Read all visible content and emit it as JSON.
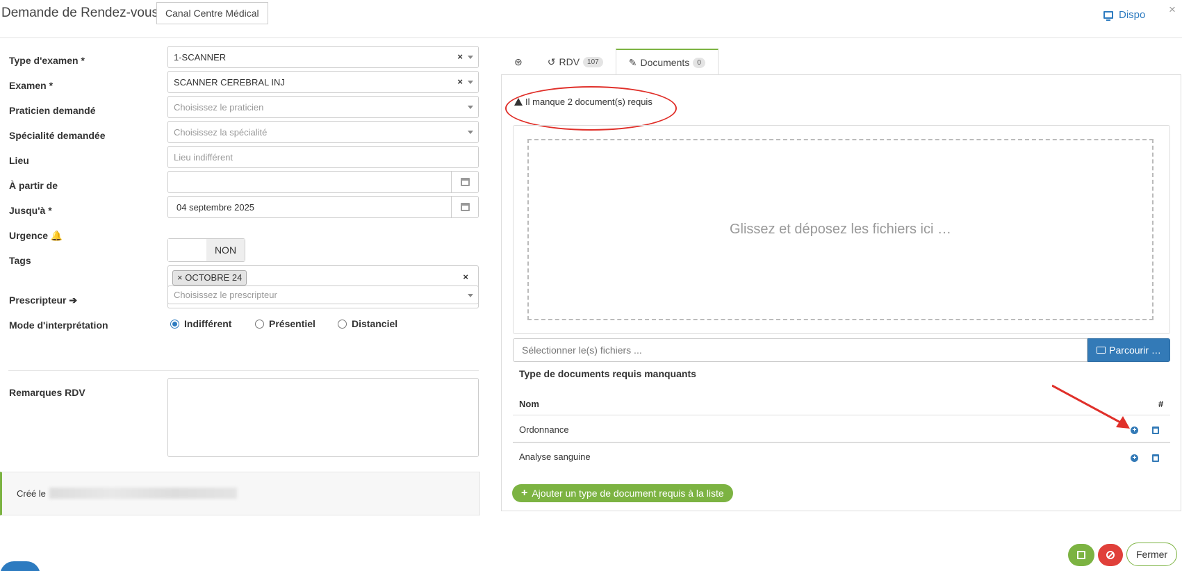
{
  "header": {
    "title": "Demande de Rendez-vous",
    "site": "Canal Centre Médical",
    "dispo": "Dispo",
    "close": "×"
  },
  "form": {
    "type_examen": {
      "label": "Type d'examen",
      "req": "*",
      "value": "1-SCANNER"
    },
    "examen": {
      "label": "Examen",
      "req": "*",
      "value": "SCANNER CEREBRAL INJ"
    },
    "praticien": {
      "label": "Praticien demandé",
      "placeholder": "Choisissez le praticien"
    },
    "specialite": {
      "label": "Spécialité demandée",
      "placeholder": "Choisissez la spécialité"
    },
    "lieu": {
      "label": "Lieu",
      "placeholder": "Lieu indifférent"
    },
    "a_partir_de": {
      "label": "À partir de",
      "value": ""
    },
    "jusqua": {
      "label": "Jusqu'à",
      "req": "*",
      "value": "04 septembre 2025"
    },
    "urgence": {
      "label": "Urgence",
      "value": "NON"
    },
    "tags": {
      "label": "Tags",
      "items": [
        "OCTOBRE 24"
      ]
    },
    "prescripteur": {
      "label": "Prescripteur",
      "placeholder": "Choisissez le prescripteur"
    },
    "mode": {
      "label": "Mode d'interprétation",
      "options": [
        "Indifférent",
        "Présentiel",
        "Distanciel"
      ],
      "selected": "Indifférent"
    },
    "remarques": {
      "label": "Remarques RDV",
      "value": ""
    },
    "created": "Créé le"
  },
  "tabs": [
    {
      "label": "",
      "icon": "fingerprint-icon"
    },
    {
      "label": "RDV",
      "badge": "107",
      "icon": "history-icon"
    },
    {
      "label": "Documents",
      "badge": "0",
      "icon": "paperclip-icon"
    }
  ],
  "documents": {
    "warning": "Il manque 2 document(s) requis",
    "dropzone": "Glissez et déposez les fichiers ici …",
    "file_placeholder": "Sélectionner le(s) fichiers ...",
    "browse": "Parcourir …",
    "section_title": "Type de documents requis manquants",
    "columns": [
      "Nom",
      "#"
    ],
    "rows": [
      {
        "name": "Ordonnance"
      },
      {
        "name": "Analyse sanguine"
      }
    ],
    "add_type": "Ajouter un type de document requis à la liste"
  },
  "footer": {
    "close": "Fermer"
  },
  "colors": {
    "primary": "#337ab7",
    "success": "#7cb342",
    "danger": "#e0403a",
    "annotation": "#e0302a"
  }
}
